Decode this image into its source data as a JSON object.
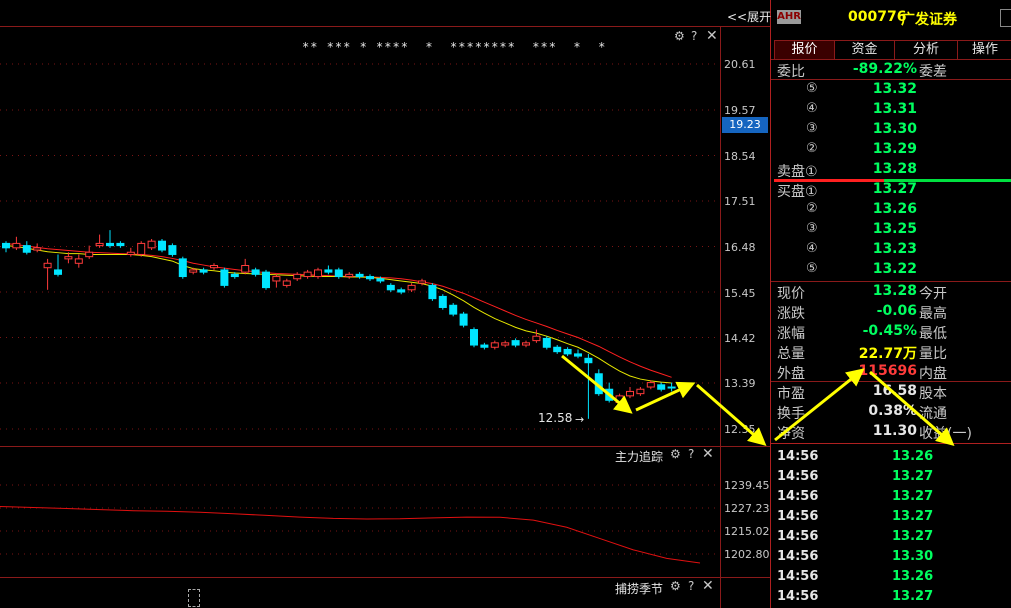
{
  "toolbar": {
    "expand_label": "<<展开"
  },
  "main_chart": {
    "stars": "** *** * ****  *  ********  ***  *  *",
    "price_ticks": [
      "20.61",
      "19.57",
      "18.54",
      "17.51",
      "16.48",
      "15.45",
      "14.42",
      "13.39",
      "12.35"
    ],
    "current_price_tag": "19.23",
    "low_annotation": "12.58"
  },
  "chart_data": {
    "type": "candlestick",
    "y_axis_ticks": [
      20.61,
      19.57,
      18.54,
      17.51,
      16.48,
      15.45,
      14.42,
      13.39,
      12.35
    ],
    "ylim": [
      12.35,
      20.61
    ],
    "low_label": 12.58,
    "candles": [
      {
        "o": 16.55,
        "c": 16.45,
        "h": 16.6,
        "l": 16.35
      },
      {
        "o": 16.45,
        "c": 16.55,
        "h": 16.7,
        "l": 16.4
      },
      {
        "o": 16.5,
        "c": 16.35,
        "h": 16.6,
        "l": 16.3
      },
      {
        "o": 16.4,
        "c": 16.45,
        "h": 16.55,
        "l": 16.35
      },
      {
        "o": 16.0,
        "c": 16.1,
        "h": 16.2,
        "l": 15.5
      },
      {
        "o": 15.95,
        "c": 15.85,
        "h": 16.3,
        "l": 15.8
      },
      {
        "o": 16.2,
        "c": 16.25,
        "h": 16.35,
        "l": 16.1
      },
      {
        "o": 16.1,
        "c": 16.2,
        "h": 16.3,
        "l": 16.0
      },
      {
        "o": 16.25,
        "c": 16.35,
        "h": 16.5,
        "l": 16.2
      },
      {
        "o": 16.5,
        "c": 16.55,
        "h": 16.75,
        "l": 16.45
      },
      {
        "o": 16.55,
        "c": 16.5,
        "h": 16.85,
        "l": 16.45
      },
      {
        "o": 16.55,
        "c": 16.5,
        "h": 16.6,
        "l": 16.45
      },
      {
        "o": 16.3,
        "c": 16.35,
        "h": 16.45,
        "l": 16.25
      },
      {
        "o": 16.3,
        "c": 16.55,
        "h": 16.6,
        "l": 16.25
      },
      {
        "o": 16.45,
        "c": 16.6,
        "h": 16.65,
        "l": 16.4
      },
      {
        "o": 16.6,
        "c": 16.4,
        "h": 16.65,
        "l": 16.35
      },
      {
        "o": 16.5,
        "c": 16.3,
        "h": 16.55,
        "l": 16.25
      },
      {
        "o": 16.2,
        "c": 15.8,
        "h": 16.25,
        "l": 15.75
      },
      {
        "o": 15.9,
        "c": 15.95,
        "h": 16.0,
        "l": 15.85
      },
      {
        "o": 15.95,
        "c": 15.9,
        "h": 16.0,
        "l": 15.85
      },
      {
        "o": 16.0,
        "c": 16.05,
        "h": 16.1,
        "l": 15.95
      },
      {
        "o": 15.95,
        "c": 15.6,
        "h": 16.0,
        "l": 15.55
      },
      {
        "o": 15.85,
        "c": 15.8,
        "h": 15.9,
        "l": 15.75
      },
      {
        "o": 15.9,
        "c": 16.05,
        "h": 16.2,
        "l": 15.85
      },
      {
        "o": 15.95,
        "c": 15.85,
        "h": 16.0,
        "l": 15.8
      },
      {
        "o": 15.9,
        "c": 15.55,
        "h": 15.95,
        "l": 15.5
      },
      {
        "o": 15.7,
        "c": 15.8,
        "h": 15.85,
        "l": 15.55
      },
      {
        "o": 15.6,
        "c": 15.7,
        "h": 15.75,
        "l": 15.55
      },
      {
        "o": 15.75,
        "c": 15.85,
        "h": 15.9,
        "l": 15.7
      },
      {
        "o": 15.8,
        "c": 15.9,
        "h": 15.95,
        "l": 15.75
      },
      {
        "o": 15.8,
        "c": 15.95,
        "h": 16.0,
        "l": 15.75
      },
      {
        "o": 15.95,
        "c": 15.9,
        "h": 16.05,
        "l": 15.85
      },
      {
        "o": 15.95,
        "c": 15.8,
        "h": 16.0,
        "l": 15.75
      },
      {
        "o": 15.8,
        "c": 15.85,
        "h": 15.9,
        "l": 15.75
      },
      {
        "o": 15.85,
        "c": 15.8,
        "h": 15.9,
        "l": 15.75
      },
      {
        "o": 15.8,
        "c": 15.75,
        "h": 15.85,
        "l": 15.7
      },
      {
        "o": 15.75,
        "c": 15.7,
        "h": 15.8,
        "l": 15.65
      },
      {
        "o": 15.6,
        "c": 15.5,
        "h": 15.65,
        "l": 15.45
      },
      {
        "o": 15.5,
        "c": 15.45,
        "h": 15.55,
        "l": 15.4
      },
      {
        "o": 15.5,
        "c": 15.6,
        "h": 15.65,
        "l": 15.45
      },
      {
        "o": 15.65,
        "c": 15.7,
        "h": 15.75,
        "l": 15.6
      },
      {
        "o": 15.6,
        "c": 15.3,
        "h": 15.65,
        "l": 15.25
      },
      {
        "o": 15.35,
        "c": 15.1,
        "h": 15.4,
        "l": 15.05
      },
      {
        "o": 15.15,
        "c": 14.95,
        "h": 15.2,
        "l": 14.9
      },
      {
        "o": 14.95,
        "c": 14.7,
        "h": 15.0,
        "l": 14.65
      },
      {
        "o": 14.6,
        "c": 14.25,
        "h": 14.65,
        "l": 14.2
      },
      {
        "o": 14.25,
        "c": 14.2,
        "h": 14.3,
        "l": 14.15
      },
      {
        "o": 14.2,
        "c": 14.3,
        "h": 14.35,
        "l": 14.15
      },
      {
        "o": 14.25,
        "c": 14.3,
        "h": 14.35,
        "l": 14.2
      },
      {
        "o": 14.35,
        "c": 14.25,
        "h": 14.4,
        "l": 14.2
      },
      {
        "o": 14.25,
        "c": 14.3,
        "h": 14.35,
        "l": 14.2
      },
      {
        "o": 14.35,
        "c": 14.45,
        "h": 14.6,
        "l": 14.3
      },
      {
        "o": 14.4,
        "c": 14.2,
        "h": 14.45,
        "l": 14.15
      },
      {
        "o": 14.2,
        "c": 14.1,
        "h": 14.25,
        "l": 14.05
      },
      {
        "o": 14.15,
        "c": 14.05,
        "h": 14.2,
        "l": 14.0
      },
      {
        "o": 14.05,
        "c": 14.0,
        "h": 14.15,
        "l": 13.95
      },
      {
        "o": 13.95,
        "c": 13.85,
        "h": 14.05,
        "l": 12.58
      },
      {
        "o": 13.6,
        "c": 13.15,
        "h": 13.7,
        "l": 13.1
      },
      {
        "o": 13.25,
        "c": 13.0,
        "h": 13.4,
        "l": 12.95
      },
      {
        "o": 12.95,
        "c": 13.1,
        "h": 13.15,
        "l": 12.9
      },
      {
        "o": 13.1,
        "c": 13.2,
        "h": 13.3,
        "l": 13.05
      },
      {
        "o": 13.15,
        "c": 13.25,
        "h": 13.3,
        "l": 13.1
      },
      {
        "o": 13.3,
        "c": 13.4,
        "h": 13.45,
        "l": 13.25
      },
      {
        "o": 13.35,
        "c": 13.25,
        "h": 13.4,
        "l": 13.2
      },
      {
        "o": 13.3,
        "c": 13.28,
        "h": 13.4,
        "l": 13.2
      }
    ],
    "ma_yellow": [
      16.5,
      16.48,
      16.44,
      16.4,
      16.36,
      16.34,
      16.32,
      16.32,
      16.3,
      16.3,
      16.3,
      16.3,
      16.3,
      16.28,
      16.25,
      16.2,
      16.15,
      16.05,
      15.98,
      15.95,
      15.93,
      15.9,
      15.88,
      15.87,
      15.86,
      15.85,
      15.84,
      15.83,
      15.82,
      15.81,
      15.8,
      15.8,
      15.8,
      15.79,
      15.79,
      15.78,
      15.76,
      15.73,
      15.7,
      15.67,
      15.64,
      15.58,
      15.5,
      15.38,
      15.25,
      15.1,
      14.97,
      14.85,
      14.75,
      14.65,
      14.57,
      14.52,
      14.45,
      14.37,
      14.28,
      14.2,
      14.08,
      13.95,
      13.8,
      13.66,
      13.55,
      13.48,
      13.44,
      13.41,
      13.39
    ],
    "ma_red": [
      16.55,
      16.52,
      16.49,
      16.46,
      16.43,
      16.41,
      16.39,
      16.37,
      16.35,
      16.34,
      16.33,
      16.32,
      16.31,
      16.3,
      16.28,
      16.25,
      16.21,
      16.16,
      16.1,
      16.06,
      16.02,
      15.99,
      15.96,
      15.93,
      15.91,
      15.89,
      15.87,
      15.86,
      15.85,
      15.84,
      15.83,
      15.82,
      15.81,
      15.8,
      15.8,
      15.79,
      15.78,
      15.77,
      15.75,
      15.72,
      15.68,
      15.64,
      15.58,
      15.5,
      15.42,
      15.32,
      15.22,
      15.12,
      15.02,
      14.92,
      14.83,
      14.75,
      14.67,
      14.58,
      14.5,
      14.42,
      14.32,
      14.22,
      14.1,
      13.98,
      13.87,
      13.77,
      13.68,
      13.6,
      13.52
    ]
  },
  "sub_chart": {
    "title": "主力追踪",
    "ticks": [
      "1239.45",
      "1227.23",
      "1215.02",
      "1202.80"
    ],
    "line_values": [
      1228,
      1227.5,
      1227,
      1226.4,
      1225.8,
      1225.5,
      1225,
      1224.2,
      1223.3,
      1222.4,
      1221.7,
      1221.4,
      1221.5,
      1222,
      1222.4,
      1222.3,
      1220.8,
      1217,
      1211,
      1205,
      1200.5,
      1198
    ]
  },
  "bottom_chart": {
    "title": "捕捞季节"
  },
  "quote": {
    "badge": "AHR",
    "code": "000776",
    "name": "广发证券",
    "tabs": [
      "报价",
      "资金",
      "分析",
      "操作"
    ],
    "wei_bi_label": "委比",
    "wei_bi_value": "-89.22%",
    "wei_cha_label": "委差",
    "sell_label": "卖盘①",
    "buy_label": "买盘①",
    "circles": [
      "⑤",
      "④",
      "③",
      "②",
      "②",
      "③",
      "④",
      "⑤"
    ],
    "sells": [
      "13.32",
      "13.31",
      "13.30",
      "13.29",
      "13.28"
    ],
    "buys": [
      "13.27",
      "13.26",
      "13.25",
      "13.23",
      "13.22"
    ],
    "stats": [
      {
        "l": "现价",
        "v": "13.28",
        "r": "今开",
        "c": "grn"
      },
      {
        "l": "涨跌",
        "v": "-0.06",
        "r": "最高",
        "c": "grn"
      },
      {
        "l": "涨幅",
        "v": "-0.45%",
        "r": "最低",
        "c": "grn"
      },
      {
        "l": "总量",
        "v": "22.77万",
        "r": "量比",
        "c": "yel"
      },
      {
        "l": "外盘",
        "v": "115696",
        "r": "内盘",
        "c": "red"
      },
      {
        "l": "市盈",
        "v": "16.58",
        "r": "股本",
        "c": "wht"
      },
      {
        "l": "换手",
        "v": "0.38%",
        "r": "流通",
        "c": "wht"
      },
      {
        "l": "净资",
        "v": "11.30",
        "r": "收益(一)",
        "c": "wht"
      }
    ],
    "ticks": [
      {
        "t": "14:56",
        "p": "13.26"
      },
      {
        "t": "14:56",
        "p": "13.27"
      },
      {
        "t": "14:56",
        "p": "13.27"
      },
      {
        "t": "14:56",
        "p": "13.27"
      },
      {
        "t": "14:56",
        "p": "13.27"
      },
      {
        "t": "14:56",
        "p": "13.30"
      },
      {
        "t": "14:56",
        "p": "13.26"
      },
      {
        "t": "14:56",
        "p": "13.27"
      }
    ]
  },
  "colors": {
    "up": "#ff3b3b",
    "down": "#00e5ff",
    "ma_yellow": "#e6e600",
    "ma_red": "#ff2020",
    "arrow": "#ffff00"
  }
}
